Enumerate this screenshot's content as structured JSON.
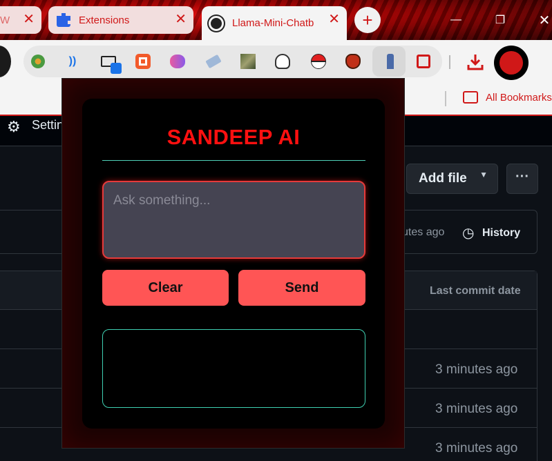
{
  "browser": {
    "tabs": [
      {
        "title": "W",
        "active": false
      },
      {
        "title": "Extensions",
        "active": false
      },
      {
        "title": "Llama-Mini-Chatb",
        "active": true
      }
    ],
    "new_tab": "+",
    "close_glyph": "✕",
    "window_controls": {
      "minimize": "—",
      "maximize": "❐",
      "close": "✕"
    },
    "extensions": [
      "flower-ext-icon",
      "wifi-ext-icon",
      "screen-ext-icon",
      "orange-circle-ext-icon",
      "brain-ext-icon",
      "eraser-ext-icon",
      "photo-ext-icon",
      "ghost-ext-icon",
      "pokeball-ext-icon",
      "mask-ext-icon",
      "llama-ext-icon",
      "puzzle-ext-icon"
    ],
    "bookmarks_label": "All Bookmarks",
    "accent": "#d01818"
  },
  "github": {
    "settings_label": "Settings",
    "add_file_label": "Add file",
    "more_label": "···",
    "commit_ago": "utes ago",
    "history_label": "History",
    "table_header": "Last commit date",
    "rows": [
      {
        "date": ""
      },
      {
        "date": "3 minutes ago"
      },
      {
        "date": "3 minutes ago"
      },
      {
        "date": "3 minutes ago"
      }
    ]
  },
  "popup": {
    "title": "SANDEEP AI",
    "input_placeholder": "Ask something...",
    "input_value": "",
    "clear_label": "Clear",
    "send_label": "Send",
    "output_text": "",
    "colors": {
      "title": "#ff1010",
      "button": "#ff5555",
      "rule": "#4fd1b8",
      "input_border": "#e63a3a"
    }
  }
}
